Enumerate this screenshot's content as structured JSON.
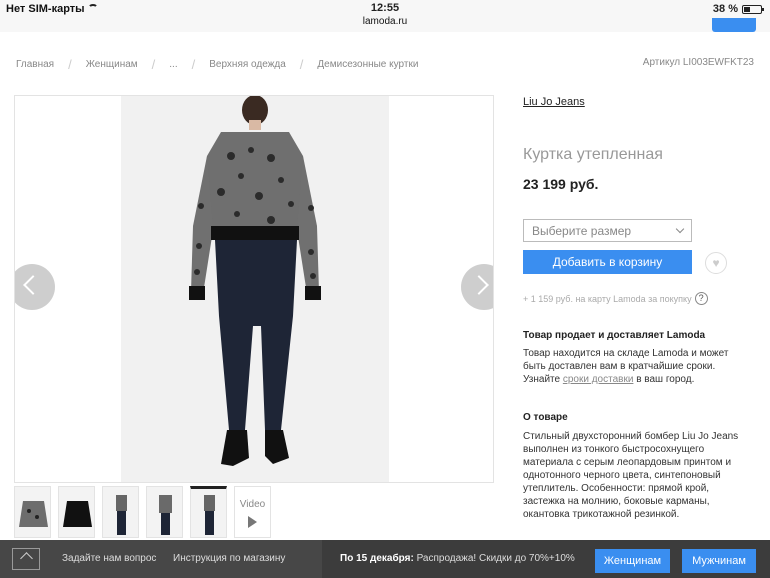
{
  "status_bar": {
    "carrier": "Нет SIM-карты",
    "time": "12:55",
    "url": "lamoda.ru",
    "battery": "38 %"
  },
  "breadcrumb": {
    "items": [
      "Главная",
      "Женщинам",
      "...",
      "Верхняя одежда",
      "Демисезонные куртки"
    ],
    "article": "Артикул LI003EWFKT23"
  },
  "gallery": {
    "video_label": "Video",
    "thumbnail_count": 5
  },
  "product": {
    "brand": "Liu Jo Jeans",
    "title": "Куртка утепленная",
    "price": "23 199 руб.",
    "size_placeholder": "Выберите размер",
    "add_to_cart": "Добавить в корзину",
    "bonus_text": "+ 1 159 руб. на карту Lamoda за покупку"
  },
  "delivery": {
    "title": "Товар продает и доставляет Lamoda",
    "text_1": "Товар находится на складе Lamoda и может быть доставлен вам в кратчайшие сроки.",
    "text_2": "Узнайте",
    "link": "сроки доставки",
    "text_3": "в ваш город."
  },
  "about": {
    "title": "О товаре",
    "text": "Стильный двухсторонний бомбер Liu Jo Jeans выполнен из тонкого быстросохнущего материала с серым леопардовым принтом и однотонного черного цвета, синтепоновый утеплитель. Особенности: прямой крой, застежка на молнию, боковые карманы, окантовка трикотажной резинкой."
  },
  "bottom_bar": {
    "ask": "Задайте нам вопрос",
    "instructions": "Инструкция по магазину",
    "promo_date": "По 15 декабря:",
    "promo_text": "Распродажа! Скидки до 70%+10%",
    "btn_women": "Женщинам",
    "btn_men": "Мужчинам"
  },
  "colors": {
    "accent": "#3a8ef0",
    "bottom_bar": "#3c3c3c"
  }
}
